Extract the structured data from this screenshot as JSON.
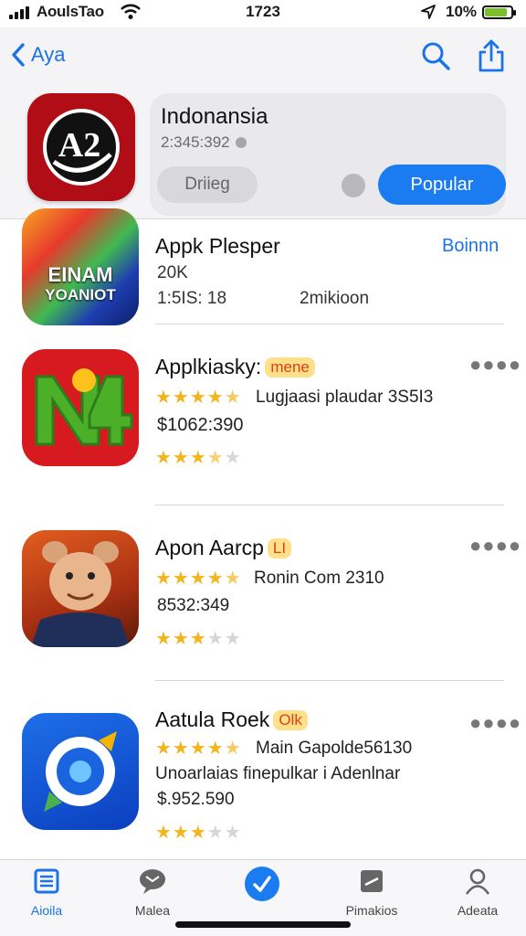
{
  "status": {
    "carrier": "AoulsTao",
    "time": "1723",
    "battery": "10%"
  },
  "nav": {
    "back_label": "Aya"
  },
  "featured": {
    "logo_text": "A2",
    "title": "Indonansia",
    "subtitle": "2:345:392",
    "secondary_button": "Driieg",
    "primary_button": "Popular"
  },
  "apps": [
    {
      "icon_text_1": "EINAM",
      "icon_text_2": "YOANIOT",
      "title": "Appk Plesper",
      "line1": "20K",
      "line2a": "1:5IS: 18",
      "line2b": "2mikioon",
      "action": "Boinnn"
    },
    {
      "title": "Applkiasky:",
      "badge": "mene",
      "stars_text": "Lugjaasi plaudar 3S5I3",
      "price": "$1062:390",
      "rating_top": 4.5,
      "rating_bottom": 3.5
    },
    {
      "title": "Apon Aarcp",
      "badge": "LI",
      "stars_text": "Ronin Com 2310",
      "price": "8532:349",
      "rating_top": 4.5,
      "rating_bottom": 3
    },
    {
      "title": "Aatula Roek",
      "badge": "Olk",
      "stars_text": "Main Gapolde56130",
      "line2": "Unoarlaias  finepulkar i Adenlnar",
      "price": "$.952.590",
      "rating_top": 4.5,
      "rating_bottom": 3
    }
  ],
  "tabs": [
    {
      "label": "Aioila",
      "icon": "list-icon"
    },
    {
      "label": "Malea",
      "icon": "chat-icon"
    },
    {
      "label": "",
      "icon": "check-circle-icon"
    },
    {
      "label": "Pimakios",
      "icon": "bookmark-icon"
    },
    {
      "label": "Adeata",
      "icon": "person-icon"
    }
  ],
  "colors": {
    "accent": "#1a7cf0",
    "star": "#f2b51e",
    "logo_red": "#b10d17"
  }
}
